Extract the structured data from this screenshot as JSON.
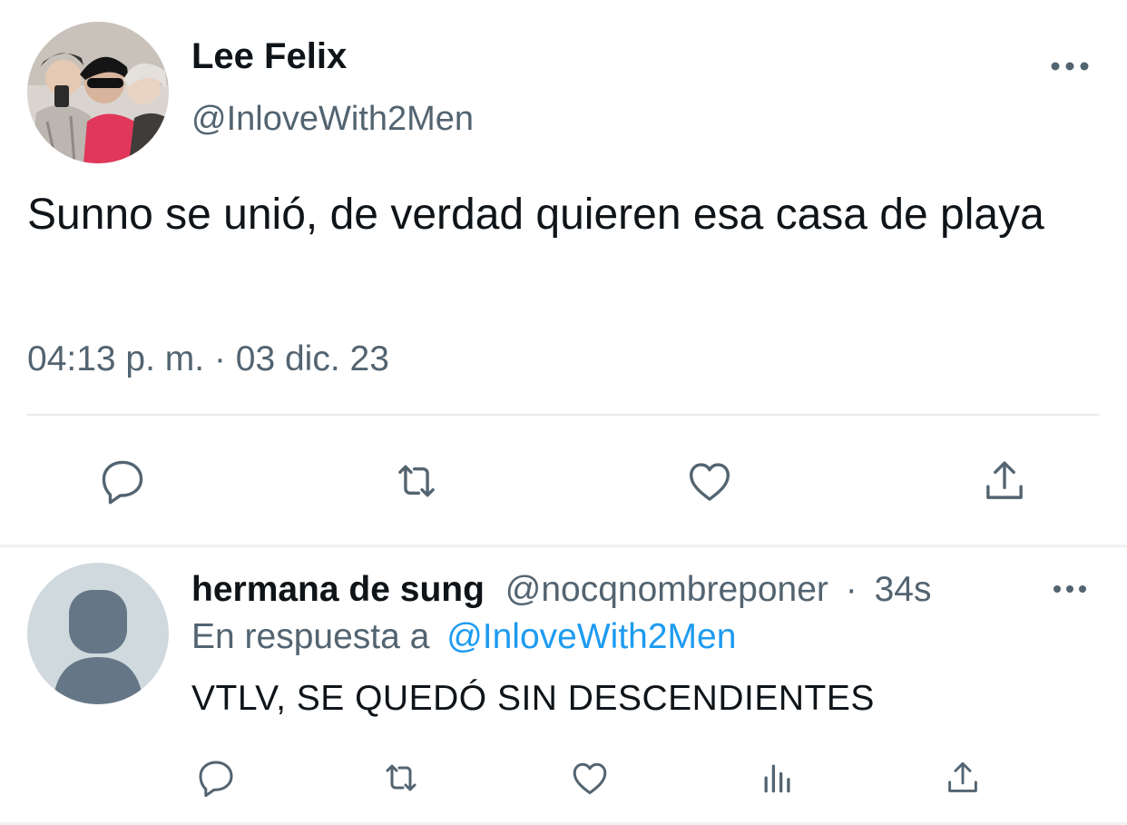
{
  "tweet": {
    "author_name": "Lee Felix",
    "author_handle": "@InloveWith2Men",
    "text": "Sunno se unió, de verdad quieren esa casa de playa",
    "timestamp": "04:13 p. m. · 03 dic. 23",
    "actions": [
      "reply-icon",
      "retweet-icon",
      "like-icon",
      "share-icon"
    ]
  },
  "reply": {
    "author_name": "hermana de sung",
    "author_handle": "@nocqnombreponer",
    "separator": "·",
    "time": "34s",
    "in_reply_prefix": "En respuesta a",
    "in_reply_handle": "@InloveWith2Men",
    "text": "VTLV, SE QUEDÓ SIN DESCENDIENTES",
    "actions": [
      "reply-icon",
      "retweet-icon",
      "like-icon",
      "views-icon",
      "share-icon"
    ]
  },
  "colors": {
    "text_primary": "#0f1419",
    "text_secondary": "#536471",
    "link": "#1d9bf0",
    "divider": "#e7eaed",
    "default_avatar_bg": "#cfd9de",
    "default_avatar_fg": "#657786"
  }
}
